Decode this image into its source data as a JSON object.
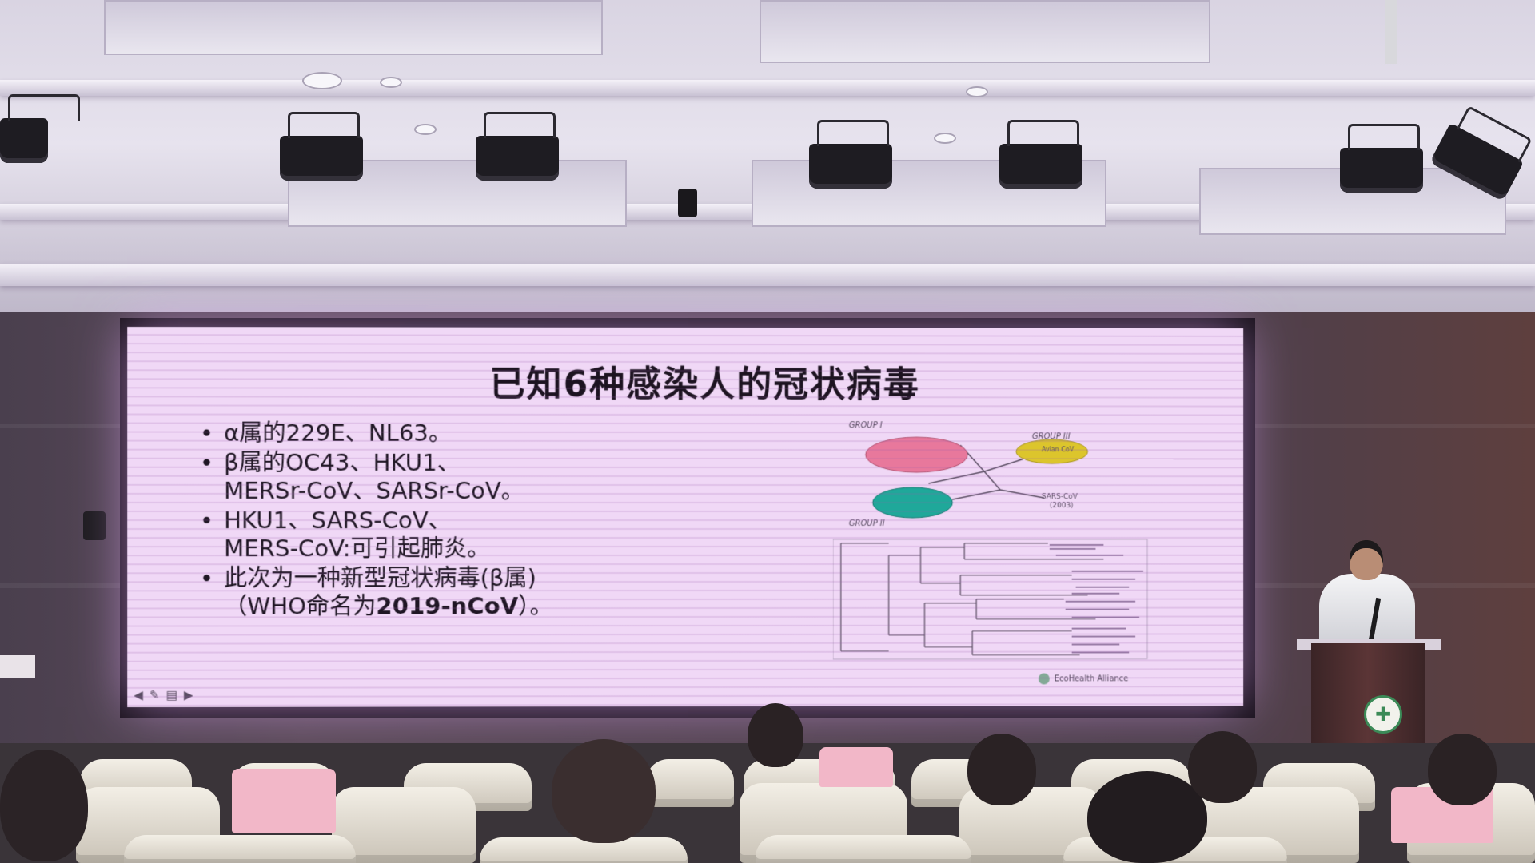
{
  "slide": {
    "title": "已知6种感染人的冠状病毒",
    "bullets": [
      {
        "lines": [
          "α属的229E、NL63。"
        ]
      },
      {
        "lines": [
          "β属的OC43、HKU1、",
          "MERSr-CoV、SARSr-CoV。"
        ]
      },
      {
        "lines": [
          "HKU1、SARS-CoV、",
          "MERS-CoV:可引起肺炎。"
        ]
      },
      {
        "lines": [
          "此次为一种新型冠状病毒(β属)"
        ],
        "tail_prefix": "（WHO命名为",
        "tail_bold": "2019-nCoV",
        "tail_suffix": "）。"
      }
    ]
  },
  "diagram": {
    "group1_label": "GROUP I",
    "group2_label": "GROUP II",
    "group3_label": "GROUP III",
    "sars_label": "SARS-CoV",
    "sars_year": "(2003)",
    "group3_node": "Avian CoV",
    "credit": "EcoHealth Alliance",
    "colors": {
      "group1": "#e8789c",
      "group2": "#1fa89a",
      "group3": "#dcc52c"
    }
  }
}
